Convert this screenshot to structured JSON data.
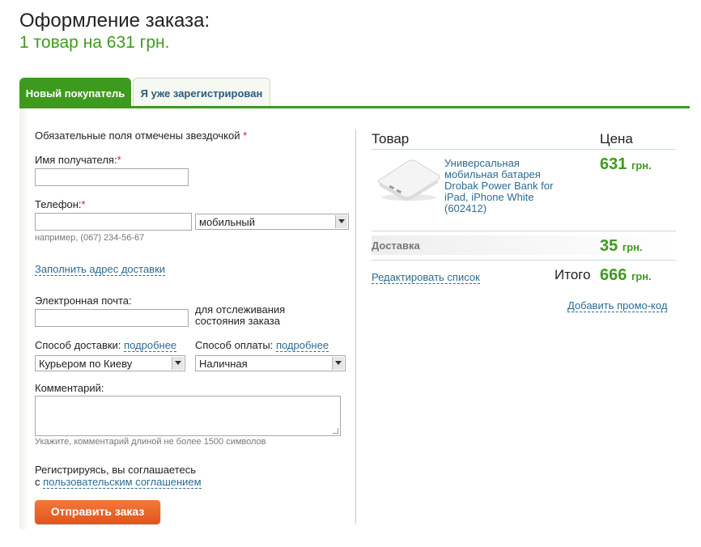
{
  "page": {
    "title": "Оформление заказа:",
    "subtitle": "1 товар на 631 грн."
  },
  "tabs": {
    "new_customer": "Новый покупатель",
    "registered": "Я уже зарегистрирован"
  },
  "form": {
    "required_note": "Обязательные поля отмечены звездочкой",
    "asterisk": "*",
    "name_label": "Имя получателя:",
    "name_value": "",
    "phone_label": "Телефон:",
    "phone_value": "",
    "phone_type": "мобильный",
    "phone_hint": "например, (067) 234-56-67",
    "fill_address_link": "Заполнить адрес доставки",
    "email_label": "Электронная почта:",
    "email_value": "",
    "email_note_line1": "для отслеживания",
    "email_note_line2": "состояния заказа",
    "delivery_label": "Способ доставки:",
    "delivery_more": "подробнее",
    "delivery_value": "Курьером по Киеву",
    "payment_label": "Способ оплаты:",
    "payment_more": "подробнее",
    "payment_value": "Наличная",
    "comment_label": "Комментарий:",
    "comment_value": "",
    "comment_hint": "Укажите, комментарий длиной не более 1500 символов",
    "agreement_line1": "Регистрируясь, вы соглашаетесь",
    "agreement_prefix": "с",
    "agreement_link": "пользовательским соглашением",
    "submit": "Отправить заказ"
  },
  "cart": {
    "col_product": "Товар",
    "col_price": "Цена",
    "item": {
      "name": "Универсальная мобильная батарея Drobak Power Bank for iPad, iPhone White (602412)",
      "price": "631",
      "currency": "грн."
    },
    "delivery_label": "Доставка",
    "delivery_price": "35",
    "delivery_currency": "грн.",
    "edit_link": "Редактировать список",
    "total_label": "Итого",
    "total_price": "666",
    "total_currency": "грн.",
    "promo_link": "Добавить промо-код"
  },
  "colors": {
    "brand_green": "#3e9a1e",
    "link_blue": "#2a6c93",
    "submit_orange": "#e9652a"
  }
}
